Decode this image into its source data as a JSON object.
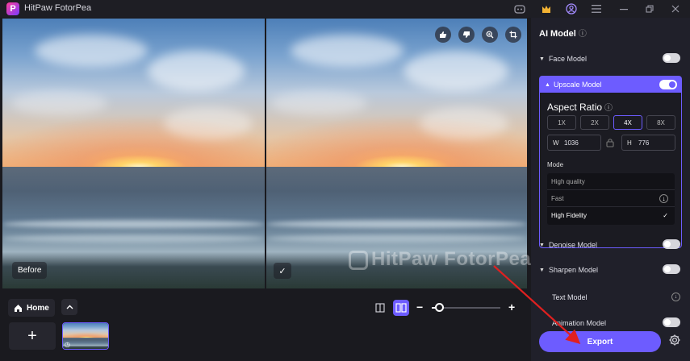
{
  "app": {
    "title": "HitPaw FotorPea",
    "logo_letter": "P"
  },
  "titlebar": {
    "icons": [
      "discord-icon",
      "crown-icon",
      "account-icon",
      "menu-icon",
      "minimize-icon",
      "restore-icon",
      "close-icon"
    ]
  },
  "canvas": {
    "before_label": "Before",
    "watermark": "HitPaw FotorPea",
    "overlay_icons": [
      "thumbs-up-icon",
      "thumbs-down-icon",
      "zoom-icon",
      "crop-icon"
    ]
  },
  "bottom": {
    "home_label": "Home",
    "zoom": {
      "minus": "−",
      "plus": "+",
      "level": 0.1
    }
  },
  "sidebar": {
    "title": "AI Model",
    "models": [
      {
        "label": "Face Model",
        "toggle": "off"
      },
      {
        "label": "Upscale Model",
        "toggle": "on"
      },
      {
        "label": "Denoise Model",
        "toggle": "off"
      },
      {
        "label": "Sharpen Model",
        "toggle": "off"
      },
      {
        "label": "Text Model"
      },
      {
        "label": "Animation Model",
        "toggle": "off"
      }
    ],
    "upscale": {
      "aspect_title": "Aspect Ratio",
      "scales": [
        "1X",
        "2X",
        "4X",
        "8X"
      ],
      "selected_scale": "4X",
      "width_label": "W",
      "width_value": "1036",
      "height_label": "H",
      "height_value": "776",
      "mode_label": "Mode",
      "modes": [
        "High quality",
        "Fast",
        "High Fidelity"
      ],
      "selected_mode": "High Fidelity"
    },
    "export_label": "Export"
  },
  "colors": {
    "accent": "#6d5cff",
    "arrow": "#e02020"
  }
}
